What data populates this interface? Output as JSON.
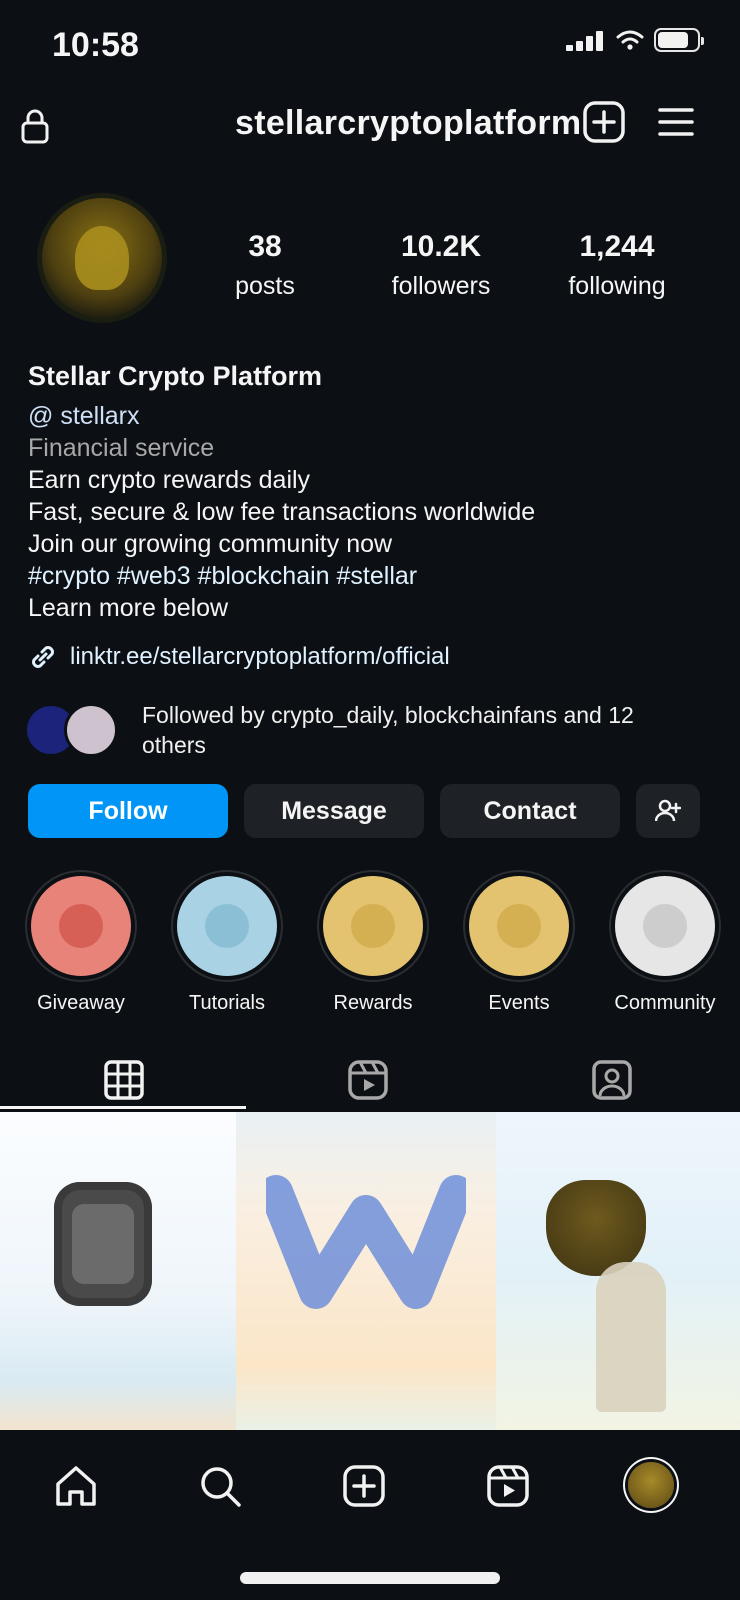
{
  "status_bar": {
    "time": "10:58",
    "battery_level": 0.8
  },
  "header": {
    "username": "stellarcryptoplatform"
  },
  "profile": {
    "stats": [
      {
        "num": "38",
        "label": "posts"
      },
      {
        "num": "10.2K",
        "label": "followers"
      },
      {
        "num": "1,244",
        "label": "following"
      }
    ],
    "name": "Stellar Crypto Platform",
    "handle": "@ stellarx",
    "category": "Financial service",
    "bio_lines": [
      "Earn crypto rewards daily",
      "Fast, secure & low fee transactions worldwide",
      "Join our growing community now",
      "#crypto #web3 #blockchain #stellar",
      "Learn more below"
    ],
    "link": "linktr.ee/stellarcryptoplatform/official",
    "followed_by": "Followed by crypto_daily, blockchainfans and 12 others"
  },
  "buttons": {
    "follow": "Follow",
    "message": "Message",
    "contact": "Contact"
  },
  "highlights": [
    {
      "label": "Giveaway",
      "color": "#e8837a"
    },
    {
      "label": "Tutorials",
      "color": "#a9d3e4"
    },
    {
      "label": "Rewards",
      "color": "#e3c270"
    },
    {
      "label": "Events",
      "color": "#e3c270"
    },
    {
      "label": "Community",
      "color": "#e6e6e6"
    }
  ],
  "colors": {
    "accent": "#0095f6",
    "background": "#0c1014",
    "surface": "#1e2226"
  }
}
